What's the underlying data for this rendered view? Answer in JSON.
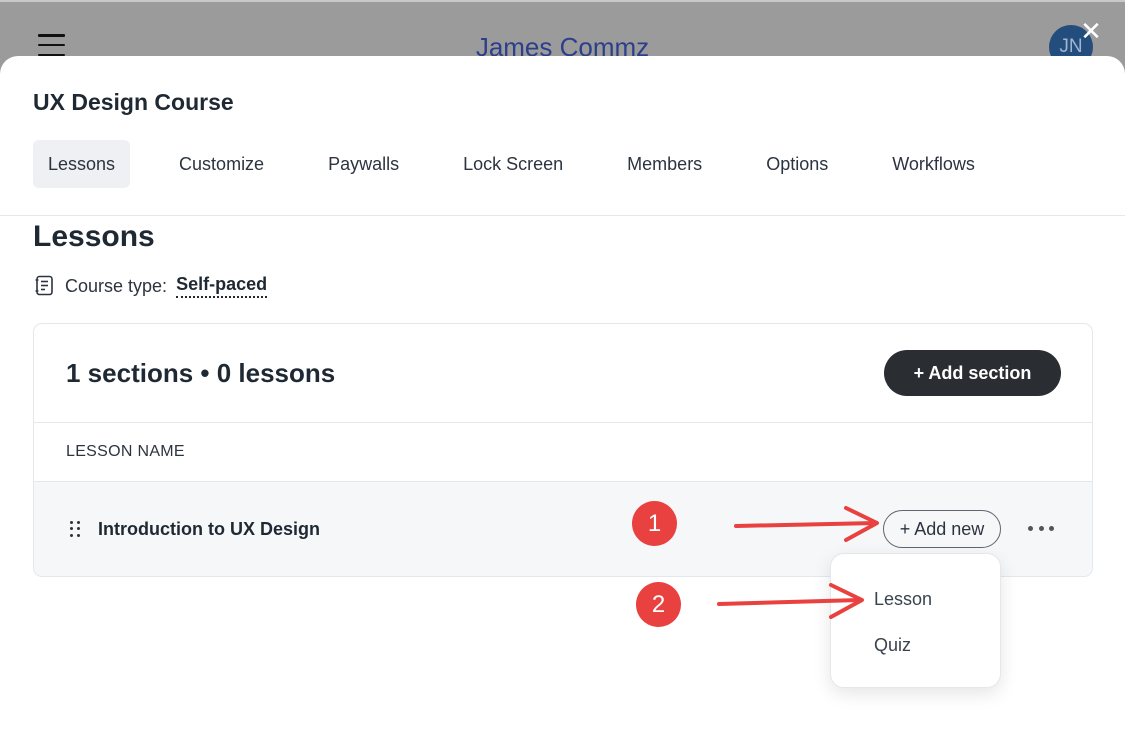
{
  "background": {
    "title": "James Commz",
    "avatar_initials": "JN"
  },
  "modal": {
    "title": "UX Design Course",
    "close_symbol": "✕",
    "tabs": [
      {
        "label": "Lessons",
        "active": true
      },
      {
        "label": "Customize",
        "active": false
      },
      {
        "label": "Paywalls",
        "active": false
      },
      {
        "label": "Lock Screen",
        "active": false
      },
      {
        "label": "Members",
        "active": false
      },
      {
        "label": "Options",
        "active": false
      },
      {
        "label": "Workflows",
        "active": false
      }
    ]
  },
  "lessons": {
    "heading": "Lessons",
    "course_type_label": "Course type:",
    "course_type_value": "Self-paced",
    "counts": "1 sections • 0 lessons",
    "add_section_label": "+ Add section",
    "column_header": "LESSON NAME",
    "sections": [
      {
        "name": "Introduction to UX Design",
        "add_new_label": "+ Add new"
      }
    ]
  },
  "dropdown": {
    "items": [
      "Lesson",
      "Quiz"
    ]
  },
  "annotations": {
    "badge1": "1",
    "badge2": "2",
    "arrow_color": "#e8413f"
  },
  "colors": {
    "primary_button": "#2a2d31",
    "annotation_red": "#e8413f",
    "active_tab_bg": "#eef0f3"
  }
}
